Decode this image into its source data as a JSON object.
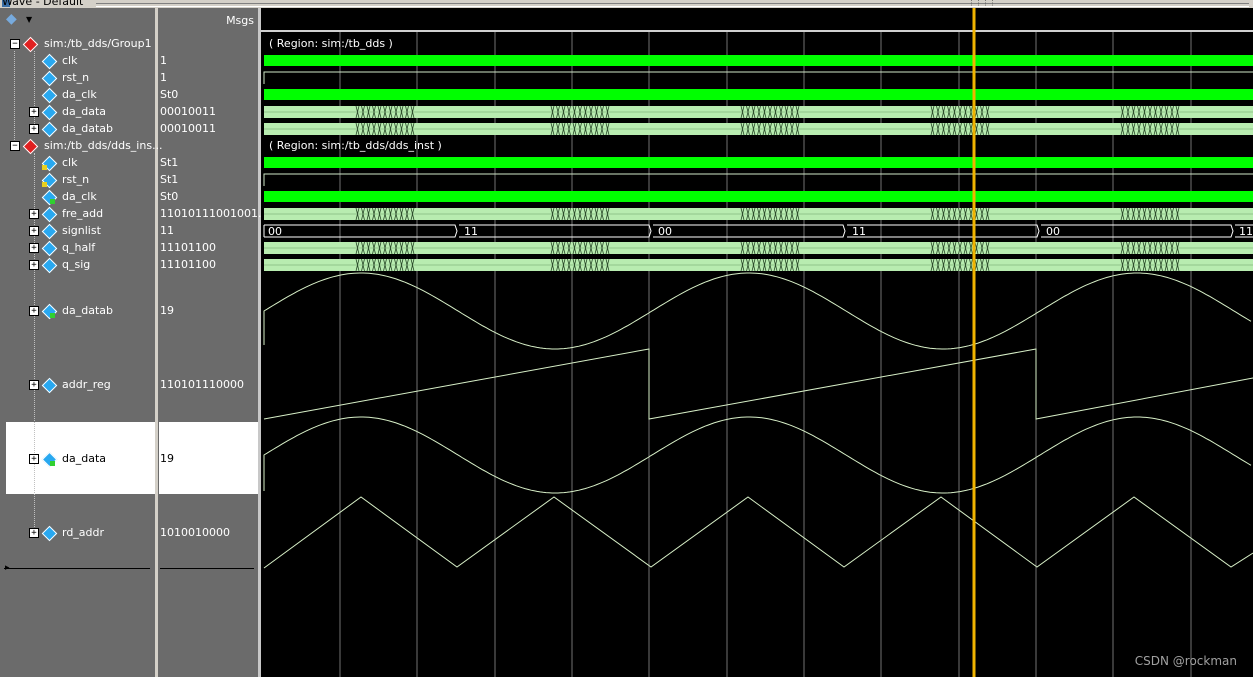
{
  "window": {
    "title": "Wave - Default"
  },
  "header": {
    "msgs_label": "Msgs"
  },
  "toolbar": {
    "icon": "wave-view-icon",
    "dropdown_icon": "chevron-down-icon"
  },
  "groups": {
    "group1": {
      "label": "sim:/tb_dds/Group1",
      "region": "( Region: sim:/tb_dds )"
    },
    "dds_inst": {
      "label": "sim:/tb_dds/dds_ins...",
      "region": "( Region: sim:/tb_dds/dds_inst )"
    }
  },
  "signals": [
    {
      "name": "clk",
      "value": "1"
    },
    {
      "name": "rst_n",
      "value": "1"
    },
    {
      "name": "da_clk",
      "value": "St0"
    },
    {
      "name": "da_data",
      "value": "00010011"
    },
    {
      "name": "da_datab",
      "value": "00010011"
    },
    {
      "name": "clk",
      "value": "St1"
    },
    {
      "name": "rst_n",
      "value": "St1"
    },
    {
      "name": "da_clk",
      "value": "St0"
    },
    {
      "name": "fre_add",
      "value": "11010111001001..."
    },
    {
      "name": "signlist",
      "value": "11"
    },
    {
      "name": "q_half",
      "value": "11101100"
    },
    {
      "name": "q_sig",
      "value": "11101100"
    },
    {
      "name": "da_datab",
      "value": "19"
    },
    {
      "name": "addr_reg",
      "value": "110101110000"
    },
    {
      "name": "da_data",
      "value": "19"
    },
    {
      "name": "rd_addr",
      "value": "1010010000"
    }
  ],
  "signlist_values": [
    "00",
    "11",
    "00",
    "11",
    "00",
    "11"
  ],
  "cursor": {
    "color": "#f0b400",
    "fraction": 0.719
  },
  "colors": {
    "high_bar": "#00ff00",
    "bus": "#b8ecb0",
    "analog": "#d8f0c8",
    "grid": "#b0b0b0"
  },
  "watermark": "CSDN @rockman"
}
